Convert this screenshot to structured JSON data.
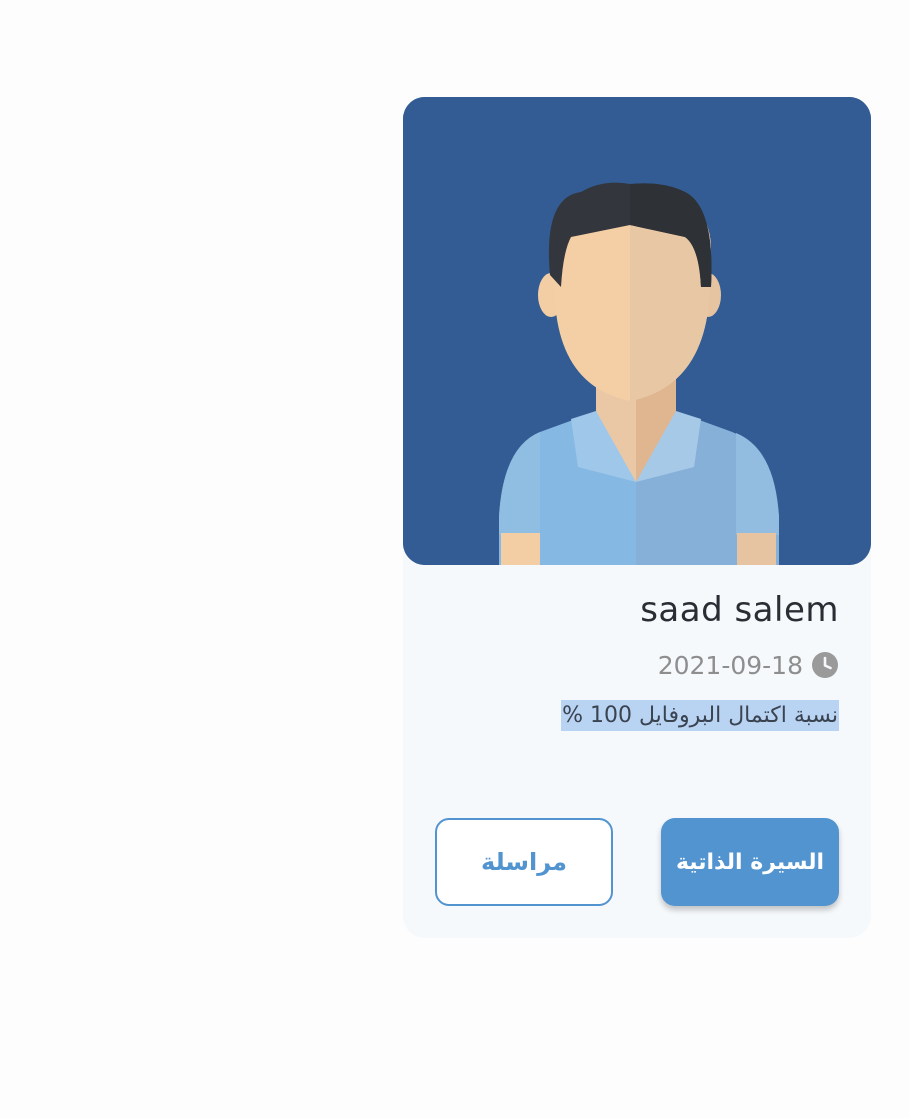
{
  "profile": {
    "name": "saad salem",
    "date": "2021-09-18",
    "completion_text": "نسبة اكتمال البروفايل 100 %",
    "avatar_icon": "male-avatar-illustration",
    "clock_icon": "clock-icon"
  },
  "actions": {
    "cv_label": "السيرة الذاتية",
    "message_label": "مراسلة"
  },
  "colors": {
    "avatar_bg": "#325c93",
    "accent": "#5294d0",
    "highlight": "#b9d3f3",
    "card_bg": "#f6f9fc"
  }
}
